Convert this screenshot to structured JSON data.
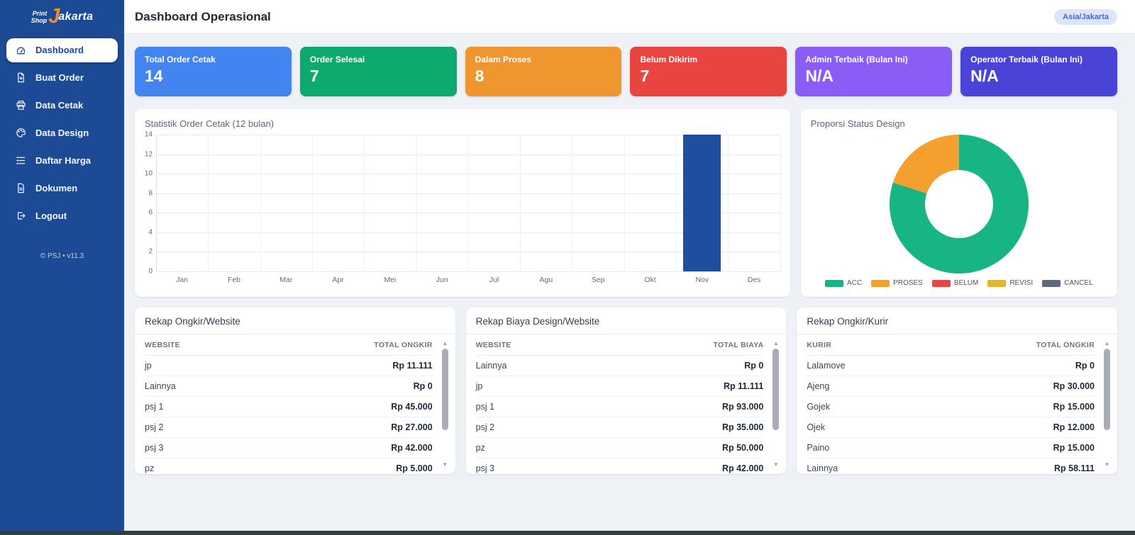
{
  "brand": {
    "line1": "Print",
    "line2": "Shop",
    "accent": "J",
    "rest": "akarta"
  },
  "sidebar": {
    "items": [
      {
        "label": "Dashboard",
        "icon": "gauge-icon",
        "active": true
      },
      {
        "label": "Buat Order",
        "icon": "file-plus-icon",
        "active": false
      },
      {
        "label": "Data Cetak",
        "icon": "printer-icon",
        "active": false
      },
      {
        "label": "Data Design",
        "icon": "palette-icon",
        "active": false
      },
      {
        "label": "Daftar Harga",
        "icon": "price-list-icon",
        "active": false
      },
      {
        "label": "Dokumen",
        "icon": "document-icon",
        "active": false
      },
      {
        "label": "Logout",
        "icon": "logout-icon",
        "active": false
      }
    ],
    "footer": "© PSJ • v11.3"
  },
  "header": {
    "title": "Dashboard Operasional",
    "timezone_badge": "Asia/Jakarta"
  },
  "stat_cards": [
    {
      "label": "Total Order Cetak",
      "value": "14",
      "color": "#4285f0"
    },
    {
      "label": "Order Selesai",
      "value": "7",
      "color": "#0caa6d"
    },
    {
      "label": "Dalam Proses",
      "value": "8",
      "color": "#f0962e"
    },
    {
      "label": "Belum Dikirim",
      "value": "7",
      "color": "#e84440"
    },
    {
      "label": "Admin Terbaik (Bulan Ini)",
      "value": "N/A",
      "color": "#8b5cf6"
    },
    {
      "label": "Operator Terbaik (Bulan Ini)",
      "value": "N/A",
      "color": "#4a43d8"
    }
  ],
  "chart_data": [
    {
      "type": "bar",
      "title": "Statistik Order Cetak (12 bulan)",
      "categories": [
        "Jan",
        "Feb",
        "Mar",
        "Apr",
        "Mei",
        "Jun",
        "Jul",
        "Agu",
        "Sep",
        "Okt",
        "Nov",
        "Des"
      ],
      "values": [
        0,
        0,
        0,
        0,
        0,
        0,
        0,
        0,
        0,
        0,
        14,
        0
      ],
      "ylim": [
        0,
        14
      ],
      "yticks": [
        14,
        12,
        10,
        8,
        6,
        4,
        2,
        0
      ],
      "bar_color": "#1f4e9e",
      "grid": true,
      "xlabel": "",
      "ylabel": ""
    },
    {
      "type": "pie",
      "title": "Proporsi Status Design",
      "labels": [
        "ACC",
        "PROSES",
        "BELUM",
        "REVISI",
        "CANCEL"
      ],
      "values_pct": [
        80,
        20,
        0,
        0,
        0
      ],
      "colors": [
        "#17b583",
        "#f59f2e",
        "#ee4445",
        "#e5b32c",
        "#5d6b7c"
      ],
      "legend_position": "bottom"
    }
  ],
  "tables": [
    {
      "title": "Rekap Ongkir/Website",
      "columns": [
        "WEBSITE",
        "TOTAL ONGKIR"
      ],
      "rows": [
        [
          "jp",
          "Rp 11.111"
        ],
        [
          "Lainnya",
          "Rp 0"
        ],
        [
          "psj 1",
          "Rp 45.000"
        ],
        [
          "psj 2",
          "Rp 27.000"
        ],
        [
          "psj 3",
          "Rp 42.000"
        ],
        [
          "pz",
          "Rp 5.000"
        ]
      ]
    },
    {
      "title": "Rekap Biaya Design/Website",
      "columns": [
        "WEBSITE",
        "TOTAL BIAYA"
      ],
      "rows": [
        [
          "Lainnya",
          "Rp 0"
        ],
        [
          "jp",
          "Rp 11.111"
        ],
        [
          "psj 1",
          "Rp 93.000"
        ],
        [
          "psj 2",
          "Rp 35.000"
        ],
        [
          "pz",
          "Rp 50.000"
        ],
        [
          "psj 3",
          "Rp 42.000"
        ]
      ]
    },
    {
      "title": "Rekap Ongkir/Kurir",
      "columns": [
        "KURIR",
        "TOTAL ONGKIR"
      ],
      "rows": [
        [
          "Lalamove",
          "Rp 0"
        ],
        [
          "Ajeng",
          "Rp 30.000"
        ],
        [
          "Gojek",
          "Rp 15.000"
        ],
        [
          "Ojek",
          "Rp 12.000"
        ],
        [
          "Paino",
          "Rp 15.000"
        ],
        [
          "Lainnya",
          "Rp 58.111"
        ]
      ]
    }
  ]
}
